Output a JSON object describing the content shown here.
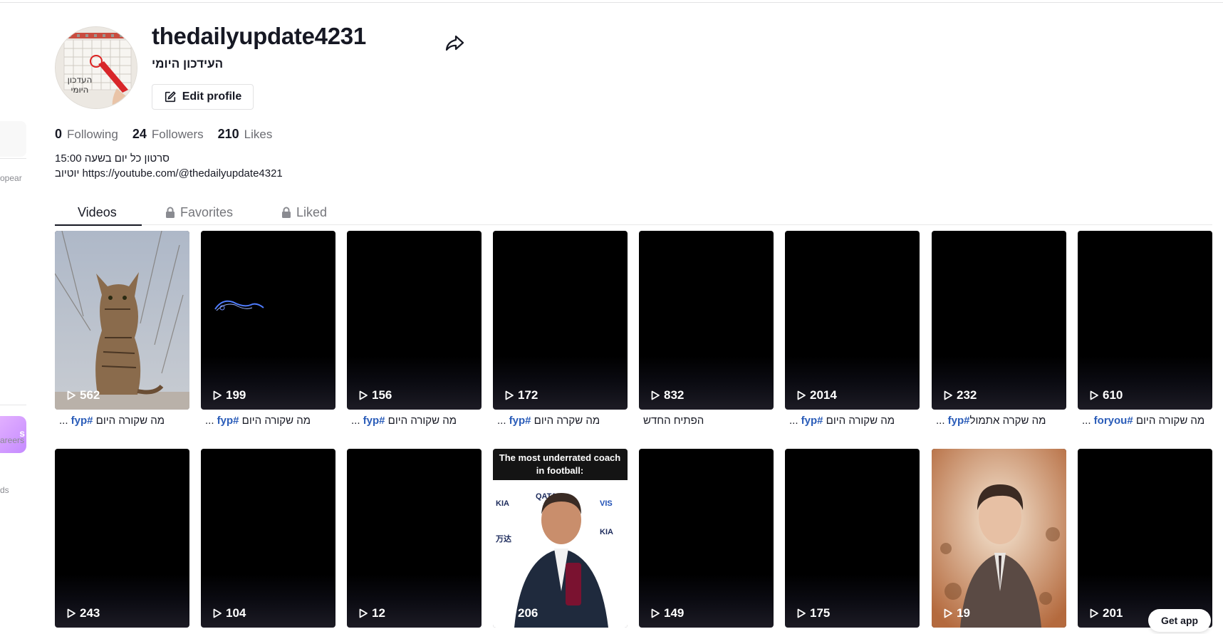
{
  "sidebar": {
    "fragments": [
      "opear",
      "areers",
      "ds"
    ],
    "promo_label": "s"
  },
  "profile": {
    "username": "thedailyupdate4231",
    "nickname": "העידכון היומי",
    "edit_label": "Edit profile",
    "avatar_text_line1": "העדכון",
    "avatar_text_line2": "היומי",
    "stats": [
      {
        "num": "0",
        "label": "Following"
      },
      {
        "num": "24",
        "label": "Followers"
      },
      {
        "num": "210",
        "label": "Likes"
      }
    ],
    "bio_line1": "סרטון כל יום בשעה 15:00",
    "bio_line2": "יוטיוב https://youtube.com/@thedailyupdate4321"
  },
  "tabs": [
    {
      "label": "Videos",
      "locked": false,
      "active": true
    },
    {
      "label": "Favorites",
      "locked": true,
      "active": false
    },
    {
      "label": "Liked",
      "locked": true,
      "active": false
    }
  ],
  "videos": [
    {
      "views": "562",
      "art": "cat",
      "caption_text": "מה שקורה היום ",
      "caption_tag": "#fyp",
      "caption_more": " ..."
    },
    {
      "views": "199",
      "art": "glow",
      "caption_text": "מה שקורה היום ",
      "caption_tag": "#fyp",
      "caption_more": " ..."
    },
    {
      "views": "156",
      "art": "black",
      "caption_text": "מה שקורה היום ",
      "caption_tag": "#fyp",
      "caption_more": " ..."
    },
    {
      "views": "172",
      "art": "black",
      "caption_text": "מה שקרה היום ",
      "caption_tag": "#fyp",
      "caption_more": " ..."
    },
    {
      "views": "832",
      "art": "black",
      "caption_text": "הפתיח החדש",
      "caption_tag": "",
      "caption_more": ""
    },
    {
      "views": "2014",
      "art": "black",
      "caption_text": "מה שקורה היום ",
      "caption_tag": "#fyp",
      "caption_more": " ..."
    },
    {
      "views": "232",
      "art": "black",
      "caption_text": "מה שקרה אתמול",
      "caption_tag": "#fyp",
      "caption_more": " ..."
    },
    {
      "views": "610",
      "art": "black",
      "caption_text": "מה שקורה היום ",
      "caption_tag": "#foryou",
      "caption_more": " ..."
    },
    {
      "views": "243",
      "art": "black",
      "caption_text": "",
      "caption_tag": "",
      "caption_more": ""
    },
    {
      "views": "104",
      "art": "black",
      "caption_text": "",
      "caption_tag": "",
      "caption_more": ""
    },
    {
      "views": "12",
      "art": "black",
      "caption_text": "",
      "caption_tag": "",
      "caption_more": ""
    },
    {
      "views": "206",
      "art": "coach",
      "caption_text": "",
      "caption_tag": "",
      "caption_more": "",
      "overlay_line1": "The most underrated coach",
      "overlay_line2": "in football:"
    },
    {
      "views": "149",
      "art": "black",
      "caption_text": "",
      "caption_tag": "",
      "caption_more": ""
    },
    {
      "views": "175",
      "art": "black",
      "caption_text": "",
      "caption_tag": "",
      "caption_more": ""
    },
    {
      "views": "19",
      "art": "man",
      "caption_text": "",
      "caption_tag": "",
      "caption_more": ""
    },
    {
      "views": "201",
      "art": "black",
      "caption_text": "",
      "caption_tag": "",
      "caption_more": ""
    }
  ],
  "get_app_label": "Get app",
  "colors": {
    "accent_tag": "#2b5db9",
    "text": "#161823",
    "muted": "#75767b"
  }
}
